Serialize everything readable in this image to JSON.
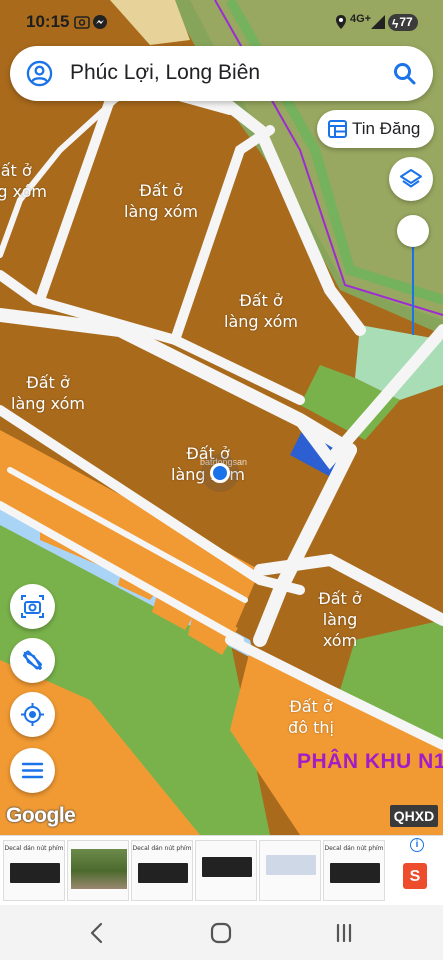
{
  "status_bar": {
    "time": "10:15",
    "network": "4G+",
    "battery": "77"
  },
  "search": {
    "query": "Phúc Lợi, Long Biên",
    "avatar_icon": "account-circle-icon",
    "search_icon": "search-icon"
  },
  "toolbar": {
    "tin_dang_label": "Tin Đăng",
    "tin_dang_icon": "listing-table-icon",
    "layers_icon": "layers-icon"
  },
  "map": {
    "labels": [
      {
        "text": "Đất ở\nlàng xóm"
      },
      {
        "text": "Đất ở\nlàng xóm"
      },
      {
        "text": "Đất ở\nlàng xóm"
      },
      {
        "text": "Đất ở\nlàng xóm"
      },
      {
        "text": "Đất ở\nlàng xóm"
      },
      {
        "text": "Đất ở\nlàng\nxóm"
      },
      {
        "text": "Đất ở\nđô thị"
      }
    ],
    "zone_label": "PHÂN KHU N1",
    "watermark": "batdongsan",
    "colors": {
      "residential_village": "#a96a1c",
      "urban_residential": "#f19a33",
      "green_space": "#79b24b",
      "light_green": "#a8ddb5",
      "road": "#f5f5f5",
      "water": "#a9d4f5",
      "public_facility": "#2c5fd1",
      "boundary": "#9d2cd3"
    }
  },
  "map_controls": [
    {
      "name": "camera-capture-button",
      "icon": "camera-icon"
    },
    {
      "name": "measure-tool-button",
      "icon": "ruler-pencil-icon"
    },
    {
      "name": "my-location-button",
      "icon": "my-location-icon"
    },
    {
      "name": "menu-button",
      "icon": "menu-icon"
    }
  ],
  "attribution": {
    "google": "Google",
    "layer_badge": "QHXD"
  },
  "ad": {
    "card_title": "Decal dán nút phím",
    "info_icon": "info-icon",
    "shop_icon": "shopee-bag-icon"
  },
  "nav": {
    "back_icon": "back-icon",
    "home_icon": "home-icon",
    "recents_icon": "recents-icon"
  }
}
